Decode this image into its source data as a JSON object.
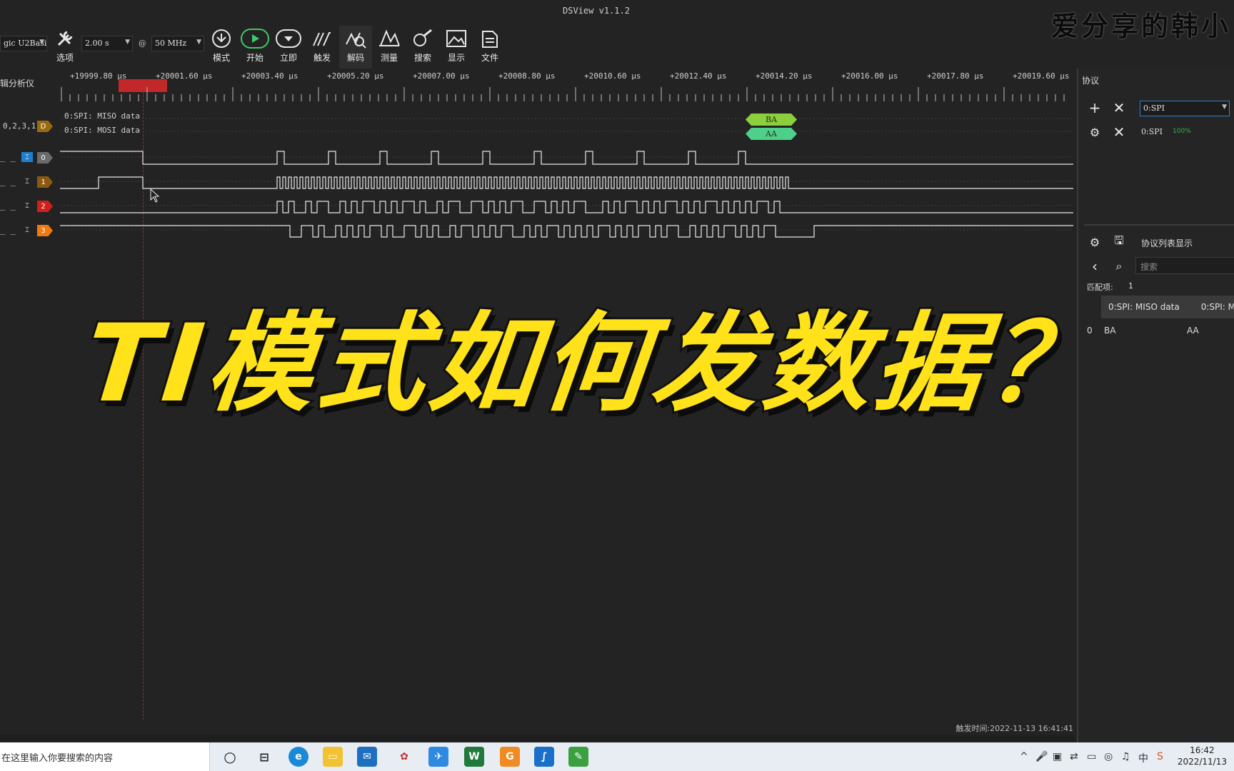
{
  "app": {
    "title": "DSView v1.1.2",
    "watermark": "爱分享的韩小"
  },
  "toolbar": {
    "device_combo": "gic U2Basi",
    "duration_combo": "2.00 s",
    "at": "@",
    "rate_combo": "50 MHz",
    "options_label": "选项",
    "buttons": [
      {
        "label": "模式",
        "icon": "mode-icon"
      },
      {
        "label": "开始",
        "icon": "play-icon"
      },
      {
        "label": "立即",
        "icon": "instant-icon"
      },
      {
        "label": "触发",
        "icon": "trigger-icon"
      },
      {
        "label": "解码",
        "icon": "decode-icon"
      },
      {
        "label": "测量",
        "icon": "measure-icon"
      },
      {
        "label": "搜索",
        "icon": "search-icon"
      },
      {
        "label": "显示",
        "icon": "display-icon"
      },
      {
        "label": "文件",
        "icon": "file-icon"
      }
    ]
  },
  "left": {
    "title": "辑分析仪",
    "decoder_channels": "0,2,3,1",
    "decoder_badge": "D"
  },
  "ruler": {
    "labels": [
      "+19999.80 µs",
      "+20001.60 µs",
      "+20003.40 µs",
      "+20005.20 µs",
      "+20007.00 µs",
      "+20008.80 µs",
      "+20010.60 µs",
      "+20012.40 µs",
      "+20014.20 µs",
      "+20016.00 µs",
      "+20017.80 µs",
      "+20019.60 µs"
    ]
  },
  "decode": {
    "rows": [
      "0:SPI: MISO data",
      "0:SPI: MOSI data"
    ],
    "values": [
      "BA",
      "AA"
    ]
  },
  "channels": [
    {
      "id": "0",
      "color": "#6b6b6b"
    },
    {
      "id": "1",
      "color": "#8a5a10"
    },
    {
      "id": "2",
      "color": "#d0201a"
    },
    {
      "id": "3",
      "color": "#f07a10"
    }
  ],
  "overlay": {
    "text": "TI模式如何发数据？"
  },
  "panel": {
    "header": "协议",
    "protocol_select": "0:SPI",
    "decoder_name": "0:SPI",
    "decoder_progress": "100%",
    "list_title": "协议列表显示",
    "search_placeholder": "搜索",
    "match_label": "匹配项:",
    "match_count": "1",
    "col1": "0:SPI: MISO data",
    "col2": "0:SPI: M",
    "row_index": "0",
    "row_val1": "BA",
    "row_val2": "AA"
  },
  "status": {
    "trigger_time": "触发时间:2022-11-13 16:41:41"
  },
  "taskbar": {
    "search_text": "在这里输入你要搜索的内容",
    "time": "16:42",
    "date": "2022/11/13"
  },
  "colors": {
    "accent_green": "#8ccf3c",
    "decode_green_2": "#4ed08a",
    "cursor_red": "#c0282a",
    "overlay_yellow": "#ffe21a"
  }
}
